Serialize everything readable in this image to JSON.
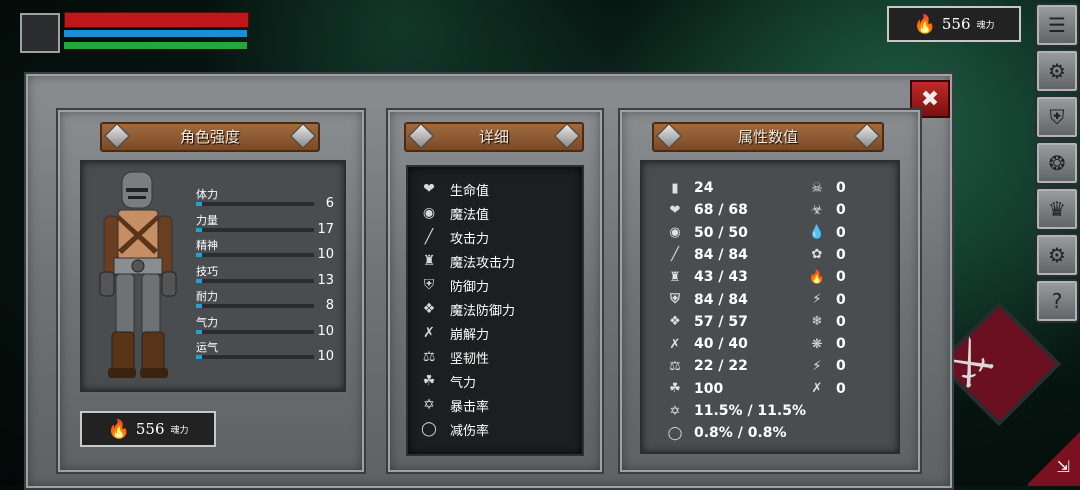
{
  "hud": {
    "soul_count": "556",
    "soul_unit": "魂力",
    "bars": {
      "hp_color": "#c0171b",
      "mp_color": "#1a8fd6",
      "stamina_color": "#25a83a"
    }
  },
  "sidebar": [
    "menu-icon",
    "character-icon",
    "helmet-icon",
    "orb-icon",
    "crown-icon",
    "settings-icon",
    "help-icon"
  ],
  "character_panel": {
    "title": "角色强度",
    "stats": [
      {
        "label": "体力",
        "value": "6",
        "fill": 0.05
      },
      {
        "label": "力量",
        "value": "17",
        "fill": 0.05
      },
      {
        "label": "精神",
        "value": "10",
        "fill": 0.05
      },
      {
        "label": "技巧",
        "value": "13",
        "fill": 0.05
      },
      {
        "label": "耐力",
        "value": "8",
        "fill": 0.05
      },
      {
        "label": "气力",
        "value": "10",
        "fill": 0.05
      },
      {
        "label": "运气",
        "value": "10",
        "fill": 0.05
      }
    ],
    "soul_count": "556",
    "soul_unit": "魂力"
  },
  "detail_panel": {
    "title": "详细",
    "rows": [
      "生命值",
      "魔法值",
      "攻击力",
      "魔法攻击力",
      "防御力",
      "魔法防御力",
      "崩解力",
      "坚韧性",
      "气力",
      "暴击率",
      "减伤率"
    ]
  },
  "attr_panel": {
    "title": "属性数值",
    "left": [
      "24",
      "68 / 68",
      "50 / 50",
      "84 / 84",
      "43 / 43",
      "84 / 84",
      "57 / 57",
      "40 / 40",
      "22 / 22",
      "100",
      "11.5% / 11.5%",
      "0.8% / 0.8%"
    ],
    "right": [
      "0",
      "0",
      "0",
      "0",
      "0",
      "0",
      "0",
      "0",
      "0",
      "0"
    ]
  }
}
